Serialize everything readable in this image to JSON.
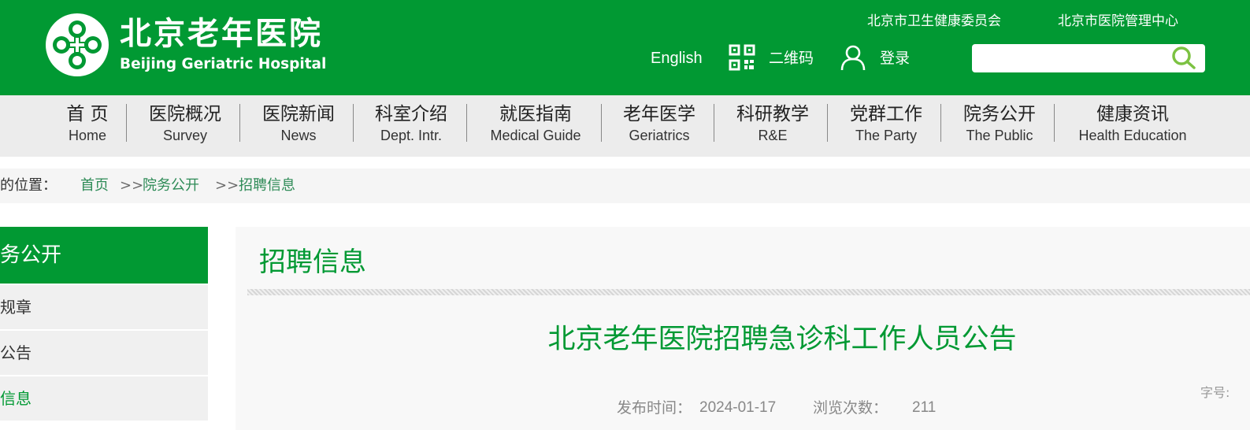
{
  "header": {
    "logo_cn": "北京老年医院",
    "logo_en": "Beijing Geriatric Hospital",
    "top_links": [
      "北京市卫生健康委员会",
      "北京市医院管理中心"
    ],
    "english_label": "English",
    "qr_label": "二维码",
    "login_label": "登录",
    "search_value": "",
    "colors": {
      "brand": "#019933",
      "accent": "#7cc242"
    }
  },
  "nav": [
    {
      "cn": "首 页",
      "en": "Home"
    },
    {
      "cn": "医院概况",
      "en": "Survey"
    },
    {
      "cn": "医院新闻",
      "en": "News"
    },
    {
      "cn": "科室介绍",
      "en": "Dept. Intr."
    },
    {
      "cn": "就医指南",
      "en": "Medical Guide"
    },
    {
      "cn": "老年医学",
      "en": "Geriatrics"
    },
    {
      "cn": "科研教学",
      "en": "R&E"
    },
    {
      "cn": "党群工作",
      "en": "The Party"
    },
    {
      "cn": "院务公开",
      "en": "The Public"
    },
    {
      "cn": "健康资讯",
      "en": "Health Education"
    }
  ],
  "breadcrumb": {
    "prefix": "的位置：",
    "items": [
      "首页",
      "院务公开",
      "招聘信息"
    ],
    "separator": ">>"
  },
  "sidebar": {
    "title": "务公开",
    "items": [
      {
        "label": "规章",
        "active": false
      },
      {
        "label": "公告",
        "active": false
      },
      {
        "label": "信息",
        "active": true
      }
    ]
  },
  "main": {
    "section_title": "招聘信息",
    "article_title": "北京老年医院招聘急诊科工作人员公告",
    "publish_label": "发布时间：",
    "publish_date": "2024-01-17",
    "views_label": "浏览次数：",
    "views": "211",
    "font_size_label": "字号:"
  }
}
